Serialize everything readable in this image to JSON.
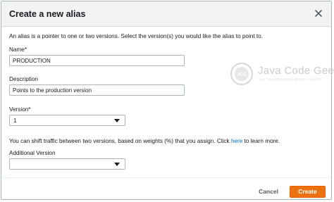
{
  "dialog": {
    "title": "Create a new alias",
    "intro": "An alias is a pointer to one or two versions. Select the version(s) you would like the alias to point to."
  },
  "form": {
    "name_label": "Name*",
    "name_value": "PRODUCTION",
    "description_label": "Description",
    "description_value": "Points to the production version",
    "version_label": "Version*",
    "version_value": "1",
    "shift_text": "You can shift traffic between two versions, based on weights (%) that you assign. Click",
    "shift_link": "here",
    "shift_suffix": "to learn more.",
    "additional_version_label": "Additional Version",
    "additional_version_value": ""
  },
  "footer": {
    "cancel_label": "Cancel",
    "create_label": "Create"
  },
  "watermark": {
    "logo_text": "JCG",
    "text": "Java Code Geeks",
    "subtext": "JAVA 2 JAVA DEVELOPERS RESOURCE CENTER"
  },
  "colors": {
    "primary_button": "#ec7211",
    "link": "#0073bb",
    "header_bg": "#f2f3f3",
    "border": "#aab7b8"
  },
  "icons": {
    "close": "close-icon",
    "dropdown": "caret-down-icon"
  }
}
